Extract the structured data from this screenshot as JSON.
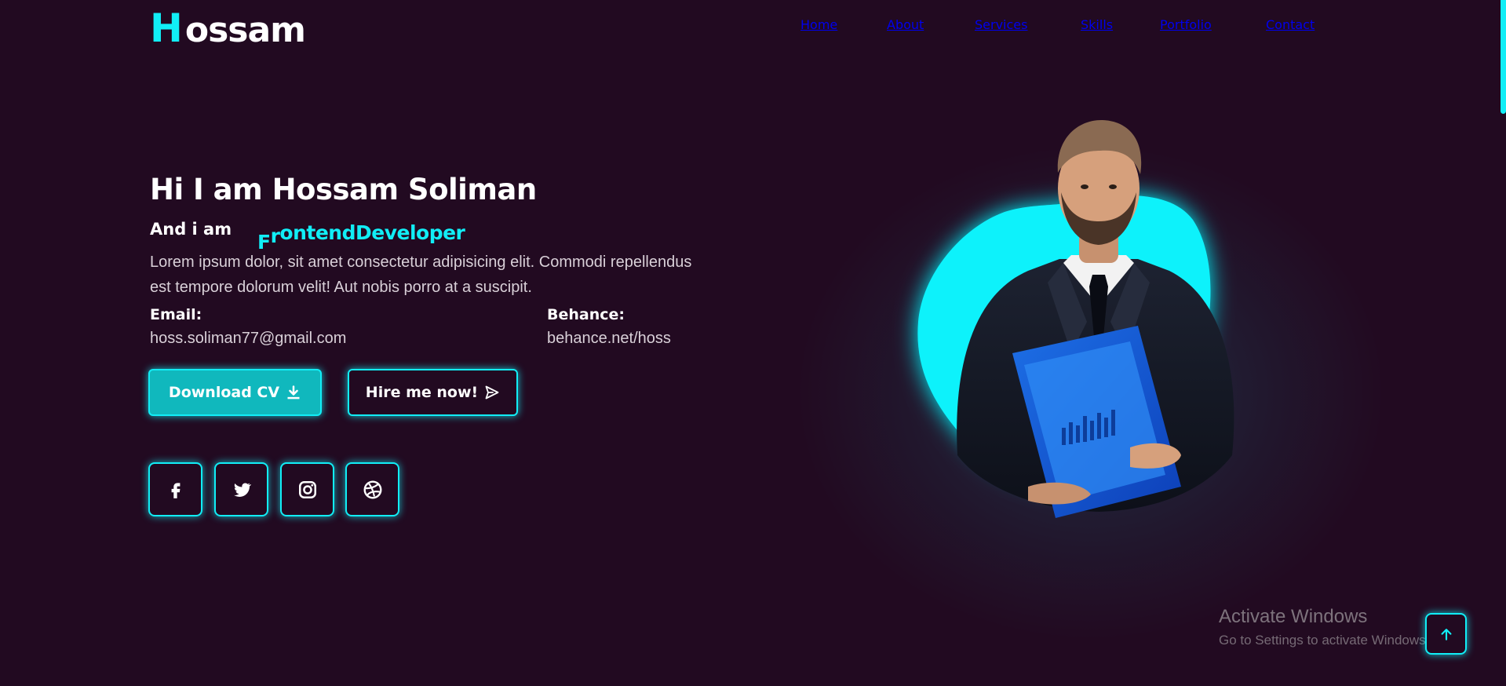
{
  "logo": {
    "first_letter": "H",
    "rest": "ossam"
  },
  "nav": [
    {
      "label": "Home"
    },
    {
      "label": "About"
    },
    {
      "label": "Services"
    },
    {
      "label": "Skills"
    },
    {
      "label": "Portfolio"
    },
    {
      "label": "Contact"
    }
  ],
  "hero": {
    "title": "Hi I am Hossam Soliman",
    "subtitle_prefix": "And i am",
    "typed_first": "F",
    "typed_second": "r",
    "typed_rest": "ontendDeveloper",
    "description": "Lorem ipsum dolor, sit amet consectetur adipisicing elit. Commodi repellendus est tempore dolorum velit! Aut nobis porro at a suscipit."
  },
  "contact_info": {
    "email_label": "Email:",
    "email_value": "hoss.soliman77@gmail.com",
    "behance_label": "Behance:",
    "behance_value": "behance.net/hoss"
  },
  "buttons": {
    "download_label": "Download CV",
    "download_icon": "download-icon",
    "hire_label": "Hire me now!",
    "hire_icon": "send-icon"
  },
  "social": [
    "facebook-icon",
    "twitter-icon",
    "instagram-icon",
    "dribbble-icon"
  ],
  "watermark": {
    "title": "Activate Windows",
    "subtitle": "Go to Settings to activate Windows."
  },
  "colors": {
    "background": "#220a21",
    "accent": "#11eef6",
    "button_fill": "#10b8bd",
    "text": "#ffffff",
    "muted_text": "#d9d0d8"
  }
}
